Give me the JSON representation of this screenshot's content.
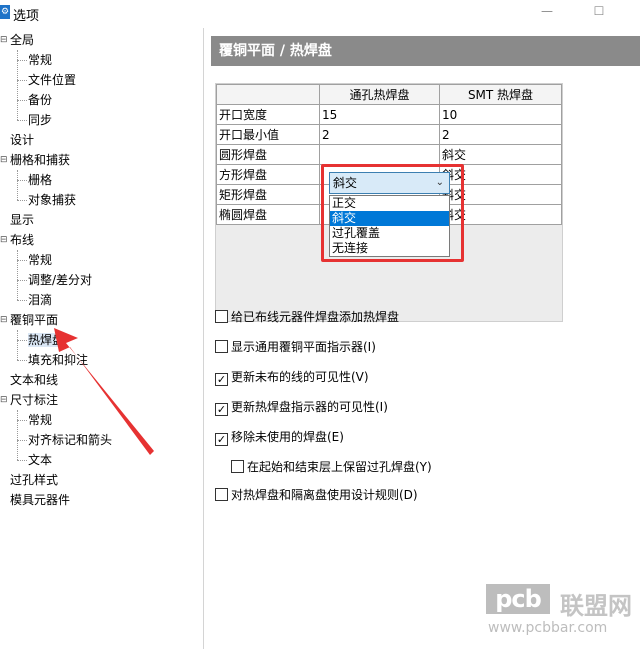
{
  "window": {
    "title": "选项",
    "app_icon": "options-app-icon",
    "minimize": "—",
    "maximize": "☐"
  },
  "tree": {
    "items": [
      {
        "label": "全局",
        "level": 0,
        "expander": "⊟"
      },
      {
        "label": "常规",
        "level": 1
      },
      {
        "label": "文件位置",
        "level": 1
      },
      {
        "label": "备份",
        "level": 1
      },
      {
        "label": "同步",
        "level": 1
      },
      {
        "label": "设计",
        "level": 0
      },
      {
        "label": "栅格和捕获",
        "level": 0,
        "expander": "⊟"
      },
      {
        "label": "栅格",
        "level": 1
      },
      {
        "label": "对象捕获",
        "level": 1
      },
      {
        "label": "显示",
        "level": 0
      },
      {
        "label": "布线",
        "level": 0,
        "expander": "⊟"
      },
      {
        "label": "常规",
        "level": 1
      },
      {
        "label": "调整/差分对",
        "level": 1
      },
      {
        "label": "泪滴",
        "level": 1
      },
      {
        "label": "覆铜平面",
        "level": 0,
        "expander": "⊟"
      },
      {
        "label": "热焊盘",
        "level": 1,
        "selected": true
      },
      {
        "label": "填充和抑注",
        "level": 1
      },
      {
        "label": "文本和线",
        "level": 0
      },
      {
        "label": "尺寸标注",
        "level": 0,
        "expander": "⊟"
      },
      {
        "label": "常规",
        "level": 1
      },
      {
        "label": "对齐标记和箭头",
        "level": 1
      },
      {
        "label": "文本",
        "level": 1
      },
      {
        "label": "过孔样式",
        "level": 0
      },
      {
        "label": "模具元器件",
        "level": 0
      }
    ]
  },
  "panel": {
    "header": "覆铜平面 / 热焊盘",
    "grid": {
      "columns": [
        "通孔热焊盘",
        "SMT 热焊盘"
      ],
      "rows": [
        {
          "label": "开口宽度",
          "through": "15",
          "smt": "10"
        },
        {
          "label": "开口最小值",
          "through": "2",
          "smt": "2"
        },
        {
          "label": "圆形焊盘",
          "through": "",
          "smt": "斜交"
        },
        {
          "label": "方形焊盘",
          "through": "",
          "smt": "斜交"
        },
        {
          "label": "矩形焊盘",
          "through": "",
          "smt": "斜交"
        },
        {
          "label": "椭圆焊盘",
          "through": "",
          "smt": "斜交"
        }
      ],
      "combo_value": "斜交",
      "dropdown_options": [
        "正交",
        "斜交",
        "过孔覆盖",
        "无连接"
      ],
      "dropdown_selected": "斜交"
    },
    "checkboxes": [
      {
        "label": "给已布线元器件焊盘添加热焊盘",
        "checked": false
      },
      {
        "label": "显示通用覆铜平面指示器(I)",
        "checked": false
      },
      {
        "label": "更新未布的线的可见性(V)",
        "checked": true
      },
      {
        "label": "更新热焊盘指示器的可见性(I)",
        "checked": true
      },
      {
        "label": "移除未使用的焊盘(E)",
        "checked": true
      },
      {
        "label": "在起始和结束层上保留过孔焊盘(Y)",
        "checked": false
      },
      {
        "label": "对热焊盘和隔离盘使用设计规则(D)",
        "checked": false
      }
    ]
  },
  "watermark": {
    "logo": "pcb",
    "name": "联盟网",
    "url": "www.pcbbar.com"
  },
  "colors": {
    "header_bg": "#8a8a8a",
    "highlight": "#0078d7",
    "annotation_red": "#e63232"
  }
}
